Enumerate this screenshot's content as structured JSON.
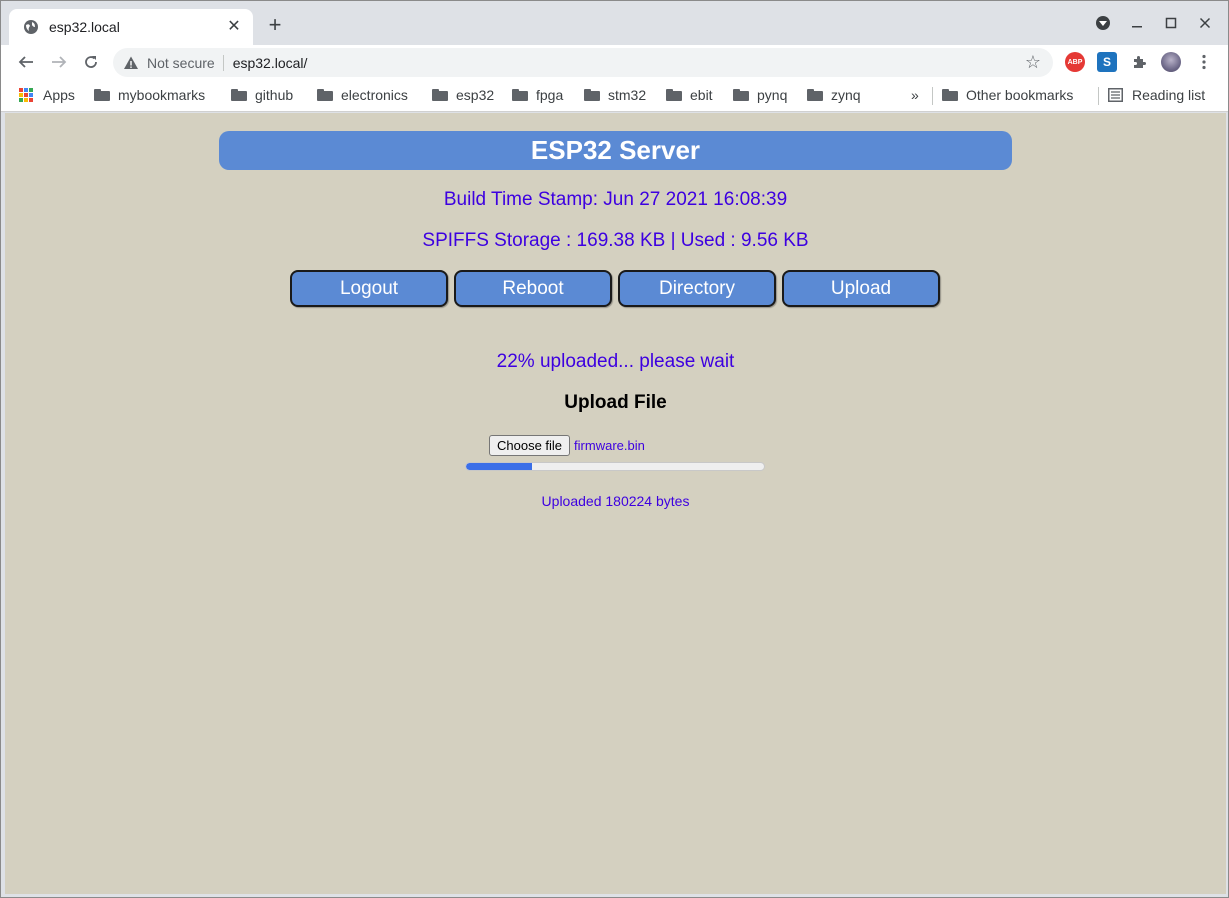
{
  "browser": {
    "tab_title": "esp32.local",
    "security_label": "Not secure",
    "url": "esp32.local/",
    "bookmarks": {
      "apps": "Apps",
      "items": [
        "mybookmarks",
        "github",
        "electronics",
        "esp32",
        "fpga",
        "stm32",
        "ebit",
        "pynq",
        "zynq"
      ],
      "overflow": "»",
      "other": "Other bookmarks",
      "reading_list": "Reading list"
    },
    "extensions": {
      "abp_label": "ABP",
      "s_label": "S"
    }
  },
  "page": {
    "background": "#d4d0c0",
    "header": "ESP32 Server",
    "build_stamp": "Build Time Stamp: Jun 27 2021 16:08:39",
    "storage": "SPIFFS Storage : 169.38 KB | Used : 9.56 KB",
    "nav_buttons": [
      "Logout",
      "Reboot",
      "Directory",
      "Upload"
    ],
    "progress_message": "22% uploaded... please wait",
    "upload_title": "Upload File",
    "choose_file_label": "Choose file",
    "selected_file": "firmware.bin",
    "progress_fraction": 0.22,
    "uploaded_bytes_text": "Uploaded 180224 bytes"
  },
  "colors": {
    "accent": "#5b8ad4",
    "text_blue": "#3d00e0",
    "progress_fill": "#3b6fe8"
  }
}
